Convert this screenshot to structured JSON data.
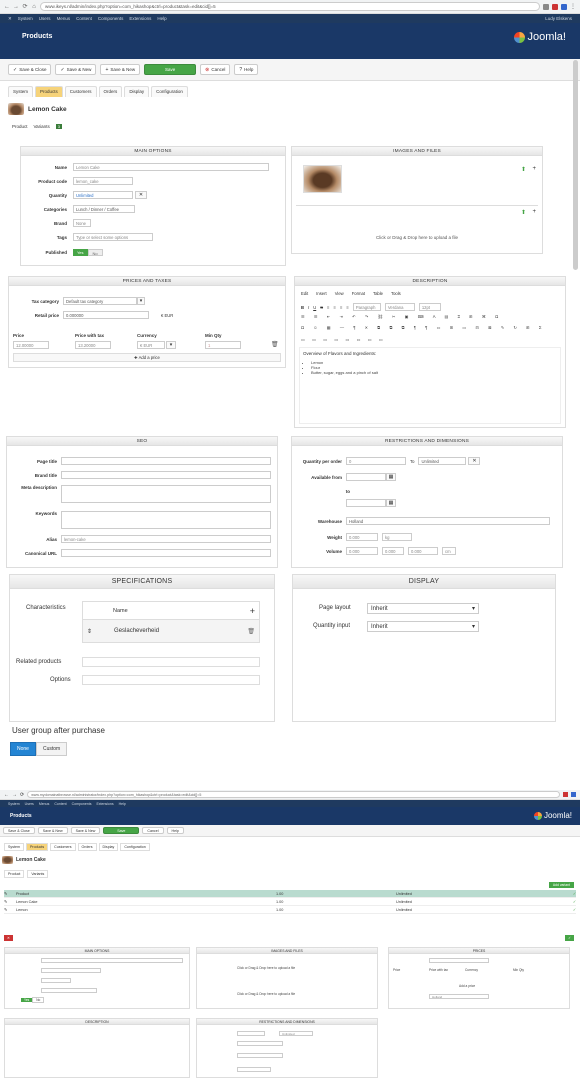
{
  "browser": {
    "url": "www.ikeys.nl/admin/index.php?option=com_hikashop&ctrl=product&task=edit&cid[]=5",
    "url2": "www.mydomainatbrowse.nl/administrator/index.php?option=com_hikashop&ctrl=product&task=edit&cid[]=5"
  },
  "menubar": {
    "items": [
      "System",
      "Users",
      "Menus",
      "Content",
      "Components",
      "Extensions",
      "Help"
    ],
    "user": "Ludy Elskens"
  },
  "header": {
    "title": "Products",
    "logo": "Joomla!"
  },
  "toolbar": {
    "buttons": [
      "Save & Close",
      "Save & New",
      "Save & New",
      "Save",
      "Cancel",
      "Help"
    ],
    "save_green": "Save"
  },
  "tabs": [
    "System",
    "Products",
    "Customers",
    "Orders",
    "Display",
    "Configuration"
  ],
  "product": {
    "name": "Lemon Cake"
  },
  "subtabs": {
    "product": "Product",
    "variants": "Variants",
    "variant_count": "3"
  },
  "main_options": {
    "title": "MAIN OPTIONS",
    "fields": [
      {
        "label": "Name",
        "value": "Lemon Cake"
      },
      {
        "label": "Product code",
        "value": "lemon_cake"
      },
      {
        "label": "Quantity",
        "value": "Unlimited"
      },
      {
        "label": "Categories",
        "value": "Lunch / Dinner / Coffee"
      },
      {
        "label": "Brand",
        "value": "None"
      },
      {
        "label": "Tags",
        "value": "Type or select some options"
      },
      {
        "label": "Published",
        "yes": "Yes",
        "no": "No"
      }
    ]
  },
  "images": {
    "title": "IMAGES AND FILES",
    "drop_text": "Click or Drag & Drop here to upload a file"
  },
  "prices": {
    "title": "PRICES AND TAXES",
    "tax_label": "Tax category",
    "tax_value": "Default tax category",
    "retail_label": "Retail price",
    "retail_value": "0.000000",
    "retail_unit": "€ EUR",
    "col_price": "Price",
    "col_with_tax": "Price with tax",
    "col_currency": "Currency",
    "col_min_qty": "Min Qty",
    "price": "12.00000",
    "with_tax": "13.20000",
    "currency": "€ EUR",
    "min_qty": "1",
    "add_price": "Add a price"
  },
  "description": {
    "title": "DESCRIPTION",
    "menu": [
      "Edit",
      "Insert",
      "View",
      "Format",
      "Table",
      "Tools"
    ],
    "format": "Paragraph",
    "font": "Verdana",
    "size": "12pt",
    "text": "Overview of Flavors and Ingredients:",
    "bullets": [
      "Lemon",
      "Flour",
      "Butter, sugar, eggs and a pinch of salt"
    ]
  },
  "seo": {
    "title": "SEO",
    "fields": [
      "Page title",
      "Brand title",
      "Meta description",
      "Keywords",
      "Alias",
      "Canonical URL"
    ],
    "alias_value": "lemon-cake"
  },
  "restrictions": {
    "title": "RESTRICTIONS AND DIMENSIONS",
    "qty_label": "Quantity per order",
    "qty_from": "0",
    "qty_to_label": "To",
    "qty_to": "Unlimited",
    "avail_from": "Available from",
    "avail_to": "to",
    "warehouse_label": "Warehouse",
    "warehouse_value": "Holland",
    "weight_label": "Weight",
    "weight_value": "0.000",
    "weight_unit": "kg",
    "volume_label": "Volume",
    "vol_l": "0.000",
    "vol_w": "0.000",
    "vol_h": "0.000",
    "vol_unit": "cm"
  },
  "specifications": {
    "title": "SPECIFICATIONS",
    "characteristics_label": "Characteristics",
    "name_header": "Name",
    "item": "Geslacheverheid",
    "related_label": "Related products",
    "options_label": "Options"
  },
  "display": {
    "title": "DISPLAY",
    "layout_label": "Page layout",
    "layout_value": "Inherit",
    "qty_input_label": "Quantity input",
    "qty_input_value": "Inherit"
  },
  "user_group": {
    "label": "User group after purchase",
    "none": "None",
    "custom": "Custom"
  },
  "s2": {
    "title": "Products",
    "product": "Lemon Cake",
    "rows": [
      {
        "name": "Product",
        "price": "1.00",
        "qty": "Unlimited"
      },
      {
        "name": "Lemon Cake",
        "price": "1.00",
        "qty": "Unlimited"
      },
      {
        "name": "Lemon",
        "price": "1.00",
        "qty": "Unlimited"
      }
    ],
    "add_label": "Add variant",
    "panel_main": "MAIN OPTIONS",
    "panel_images": "IMAGES AND FILES",
    "panel_prices": "PRICES",
    "panel_desc": "DESCRIPTION",
    "panel_restr": "RESTRICTIONS AND DIMENSIONS"
  },
  "colors": {
    "header": "#1a3867",
    "green": "#46a546",
    "tab_active": "#f6d37a"
  }
}
